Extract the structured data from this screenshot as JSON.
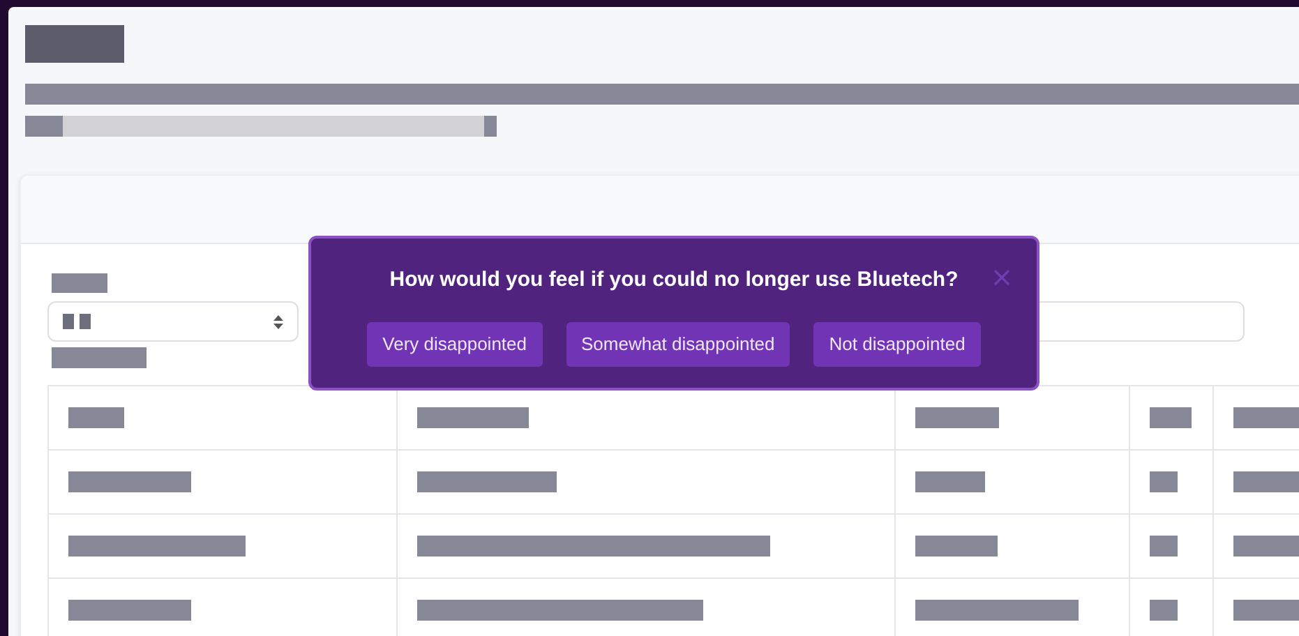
{
  "survey_popup": {
    "question": "How would you feel if you could no longer use Bluetech?",
    "options": [
      {
        "label": "Very disappointed"
      },
      {
        "label": "Somewhat disappointed"
      },
      {
        "label": "Not disappointed"
      }
    ]
  }
}
